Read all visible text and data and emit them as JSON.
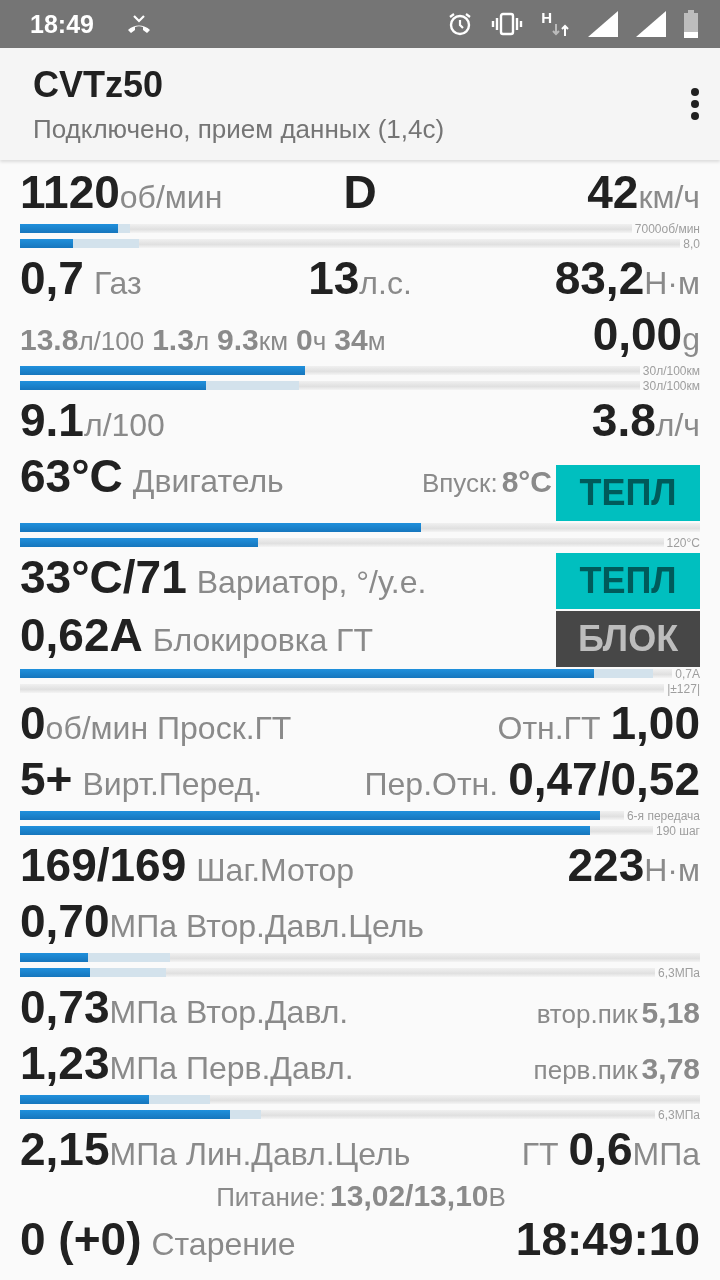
{
  "status_bar": {
    "time": "18:49",
    "network_type": "H"
  },
  "app_bar": {
    "title": "CVTz50",
    "subtitle": "Подключено, прием данных (1,4с)"
  },
  "blocks": [
    {
      "kind": "row",
      "left": [
        {
          "kind": "value",
          "text": "1120"
        },
        {
          "kind": "unit",
          "text": "об/мин"
        }
      ],
      "center": [
        {
          "kind": "value",
          "text": "D"
        }
      ],
      "right": [
        {
          "kind": "value",
          "text": "42"
        },
        {
          "kind": "unit",
          "text": "км/ч"
        }
      ]
    },
    {
      "kind": "bars",
      "bars": [
        {
          "level": 0.16,
          "peak": {
            "level": 0.18
          },
          "scale": "7000об/мин"
        },
        {
          "level": 0.08,
          "peak": {
            "level": 0.18
          },
          "scale": "8,0"
        }
      ]
    },
    {
      "kind": "row",
      "left": [
        {
          "kind": "value",
          "text": "0,7"
        },
        {
          "kind": "label",
          "text": "Газ"
        }
      ],
      "center": [
        {
          "kind": "value",
          "text": "13"
        },
        {
          "kind": "unit",
          "text": "л.с."
        }
      ],
      "right": [
        {
          "kind": "value",
          "text": "83,2"
        },
        {
          "kind": "unit",
          "text": "Н·м"
        }
      ]
    },
    {
      "kind": "row",
      "left": [
        {
          "kind": "muted",
          "text": "13.8"
        },
        {
          "kind": "small_unit",
          "text": "л/100"
        },
        {
          "kind": "muted",
          "text": "1.3"
        },
        {
          "kind": "small_unit",
          "text": "л"
        },
        {
          "kind": "muted",
          "text": "9.3"
        },
        {
          "kind": "small_unit",
          "text": "км"
        },
        {
          "kind": "muted",
          "text": "0"
        },
        {
          "kind": "small_unit",
          "text": "ч"
        },
        {
          "kind": "muted",
          "text": "34"
        },
        {
          "kind": "small_unit",
          "text": "м"
        }
      ],
      "right": [
        {
          "kind": "value",
          "text": "0,00"
        },
        {
          "kind": "unit",
          "text": "g"
        }
      ]
    },
    {
      "kind": "bars",
      "bars": [
        {
          "level": 0.46,
          "scale": "30л/100км"
        },
        {
          "level": 0.3,
          "peak": {
            "level": 0.45
          },
          "scale": "30л/100км"
        }
      ]
    },
    {
      "kind": "row",
      "left": [
        {
          "kind": "value",
          "text": "9.1"
        },
        {
          "kind": "unit",
          "text": "л/100"
        }
      ],
      "right": [
        {
          "kind": "value",
          "text": "3.8"
        },
        {
          "kind": "unit",
          "text": "л/ч"
        }
      ]
    },
    {
      "kind": "row",
      "left": [
        {
          "kind": "value",
          "text": "63°C"
        },
        {
          "kind": "label",
          "text": "Двигатель"
        }
      ],
      "right": [
        {
          "kind": "small_label",
          "text": "Впуск:"
        },
        {
          "kind": "muted",
          "text": "8°C"
        },
        {
          "kind": "badge",
          "text": "ТЕПЛ",
          "color": "#00bfbf"
        }
      ]
    },
    {
      "kind": "bars",
      "bars": [
        {
          "level": 0.59
        },
        {
          "level": 0.37,
          "scale": "120°C"
        }
      ]
    },
    {
      "kind": "row",
      "left": [
        {
          "kind": "value",
          "text": "33°C/71"
        },
        {
          "kind": "label",
          "text": "Вариатор, °/у.е."
        }
      ],
      "right": [
        {
          "kind": "badge",
          "text": "ТЕПЛ",
          "color": "#00bfbf"
        }
      ]
    },
    {
      "kind": "row",
      "left": [
        {
          "kind": "value",
          "text": "0,62A"
        },
        {
          "kind": "label",
          "text": "Блокировка ГТ"
        }
      ],
      "right": [
        {
          "kind": "badge",
          "text": "БЛОК",
          "color": "#474747"
        }
      ]
    },
    {
      "kind": "bars",
      "bars": [
        {
          "level": 0.88,
          "peak": {
            "level": 0.97
          },
          "scale": "0,7A"
        },
        {
          "scale": "|±127|"
        }
      ]
    },
    {
      "kind": "row",
      "left": [
        {
          "kind": "value",
          "text": "0"
        },
        {
          "kind": "unit",
          "text": "об/мин Проск.ГТ"
        }
      ],
      "right": [
        {
          "kind": "label",
          "text": "Отн.ГТ"
        },
        {
          "kind": "value",
          "text": "1,00"
        }
      ]
    },
    {
      "kind": "row",
      "left": [
        {
          "kind": "value",
          "text": "5+"
        },
        {
          "kind": "label",
          "text": "Вирт.Перед."
        }
      ],
      "right": [
        {
          "kind": "label",
          "text": "Пер.Отн."
        },
        {
          "kind": "value",
          "text": "0,47/0,52"
        }
      ]
    },
    {
      "kind": "bars",
      "bars": [
        {
          "level": 0.96,
          "scale": "6-я передача"
        },
        {
          "level": 0.9,
          "scale": "190 шаг"
        }
      ]
    },
    {
      "kind": "row",
      "left": [
        {
          "kind": "value",
          "text": "169/169"
        },
        {
          "kind": "label",
          "text": "Шаг.Мотор"
        }
      ],
      "right": [
        {
          "kind": "value",
          "text": "223"
        },
        {
          "kind": "unit",
          "text": "Н·м"
        }
      ]
    },
    {
      "kind": "row",
      "left": [
        {
          "kind": "value",
          "text": "0,70"
        },
        {
          "kind": "unit",
          "text": "МПа Втор.Давл.Цель"
        }
      ]
    },
    {
      "kind": "bars",
      "bars": [
        {
          "level": 0.1,
          "peak": {
            "level": 0.22
          }
        },
        {
          "level": 0.11,
          "peak": {
            "level": 0.23
          },
          "scale": "6,3МПа"
        }
      ]
    },
    {
      "kind": "row",
      "left": [
        {
          "kind": "value",
          "text": "0,73"
        },
        {
          "kind": "unit",
          "text": "МПа Втор.Давл."
        }
      ],
      "right": [
        {
          "kind": "small_label",
          "text": "втор.пик"
        },
        {
          "kind": "muted",
          "text": "5,18"
        }
      ]
    },
    {
      "kind": "row",
      "left": [
        {
          "kind": "value",
          "text": "1,23"
        },
        {
          "kind": "unit",
          "text": "МПа Перв.Давл."
        }
      ],
      "right": [
        {
          "kind": "small_label",
          "text": "перв.пик"
        },
        {
          "kind": "muted",
          "text": "3,78"
        }
      ]
    },
    {
      "kind": "bars",
      "bars": [
        {
          "level": 0.19,
          "peak": {
            "level": 0.28
          }
        },
        {
          "level": 0.33,
          "peak": {
            "level": 0.38
          },
          "scale": "6,3МПа"
        }
      ]
    },
    {
      "kind": "row",
      "left": [
        {
          "kind": "value",
          "text": "2,15"
        },
        {
          "kind": "unit",
          "text": "МПа Лин.Давл.Цель"
        }
      ],
      "right": [
        {
          "kind": "label",
          "text": "ГТ"
        },
        {
          "kind": "value",
          "text": "0,6"
        },
        {
          "kind": "unit",
          "text": "МПа"
        }
      ]
    },
    {
      "kind": "note",
      "center": [
        {
          "kind": "small_label",
          "text": "Питание:"
        },
        {
          "kind": "muted",
          "text": "13,02/13,10"
        },
        {
          "kind": "small_unit",
          "text": "В"
        }
      ]
    },
    {
      "kind": "row",
      "left": [
        {
          "kind": "value",
          "text": "0 (+0)"
        },
        {
          "kind": "label",
          "text": "Старение"
        }
      ],
      "right": [
        {
          "kind": "value",
          "text": "18:49:10"
        }
      ]
    }
  ]
}
